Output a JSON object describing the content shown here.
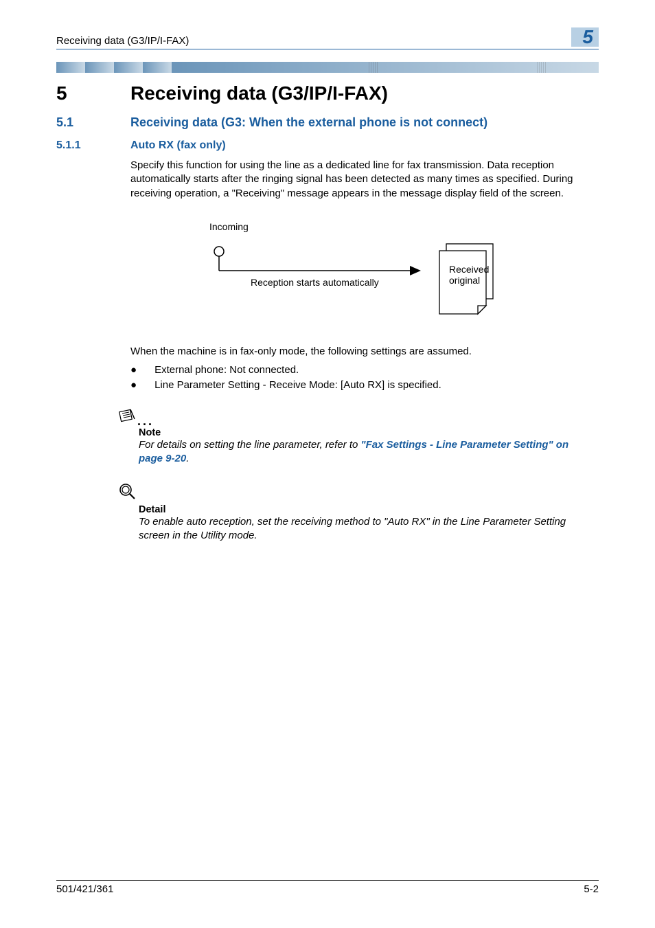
{
  "header": {
    "running_title": "Receiving data (G3/IP/I-FAX)",
    "chapter_num": "5"
  },
  "h1": {
    "num": "5",
    "title": "Receiving data (G3/IP/I-FAX)"
  },
  "h2": {
    "num": "5.1",
    "title": "Receiving data (G3: When the external phone is not connect)"
  },
  "h3": {
    "num": "5.1.1",
    "title": "Auto RX (fax only)"
  },
  "para1": "Specify this function for using the line as a dedicated line for fax transmission. Data reception automatically starts after the ringing signal has been detected as many times as specified. During receiving operation, a \"Receiving\" message appears in the message display field of the screen.",
  "diagram": {
    "incoming": "Incoming",
    "arrow_caption": "Reception starts automatically",
    "doc_line1": "Received",
    "doc_line2": "original"
  },
  "para2": "When the machine is in fax-only mode, the following settings are assumed.",
  "bullets": {
    "b1": "External phone: Not connected.",
    "b2": "Line Parameter Setting - Receive Mode: [Auto RX] is specified."
  },
  "note": {
    "label": "Note",
    "text_before": "For details on setting the line parameter, refer to ",
    "link": "\"Fax Settings - Line Parameter Setting\" on page 9-20",
    "text_after": "."
  },
  "detail": {
    "label": "Detail",
    "text": "To enable auto reception, set the receiving method to \"Auto RX\" in the Line Parameter Setting screen in the Utility mode."
  },
  "footer": {
    "model": "501/421/361",
    "page": "5-2"
  }
}
